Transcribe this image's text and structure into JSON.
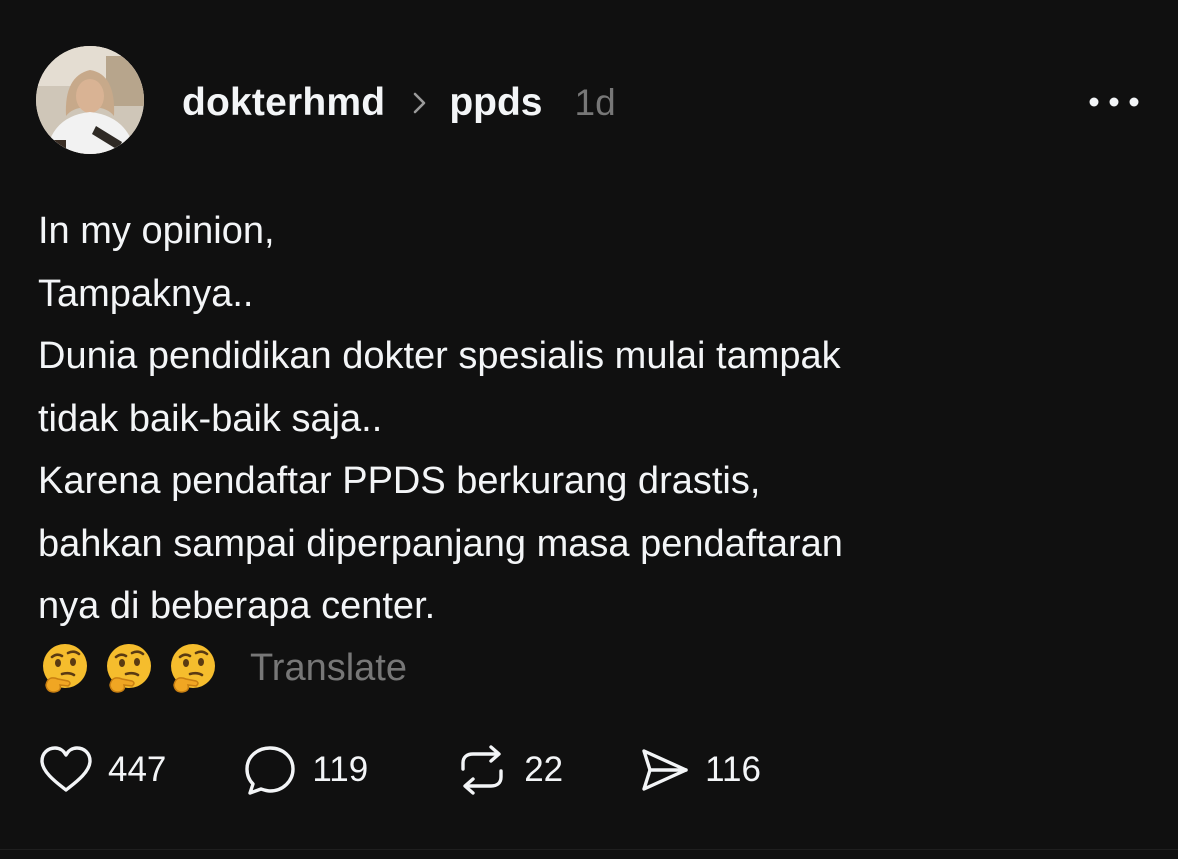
{
  "post": {
    "author": "dokterhmd",
    "topic": "ppds",
    "time": "1d",
    "lines": [
      "In my opinion,",
      "Tampaknya..",
      "Dunia pendidikan dokter spesialis mulai tampak",
      "tidak baik-baik saja..",
      "Karena pendaftar PPDS berkurang drastis,",
      "bahkan sampai diperpanjang masa pendaftaran",
      "nya di beberapa center."
    ],
    "emojis": [
      "thinking-face",
      "thinking-face",
      "thinking-face"
    ],
    "translate_label": "Translate",
    "counts": {
      "likes": "447",
      "replies": "119",
      "reposts": "22",
      "shares": "116"
    }
  },
  "icons": {
    "chevron": "chevron-right-icon",
    "more": "more-dots-icon",
    "like": "heart-icon",
    "reply": "speech-bubble-icon",
    "repost": "repost-icon",
    "share": "send-icon"
  },
  "colors": {
    "background": "#101010",
    "text": "#f3f5f7",
    "muted": "#777777"
  }
}
